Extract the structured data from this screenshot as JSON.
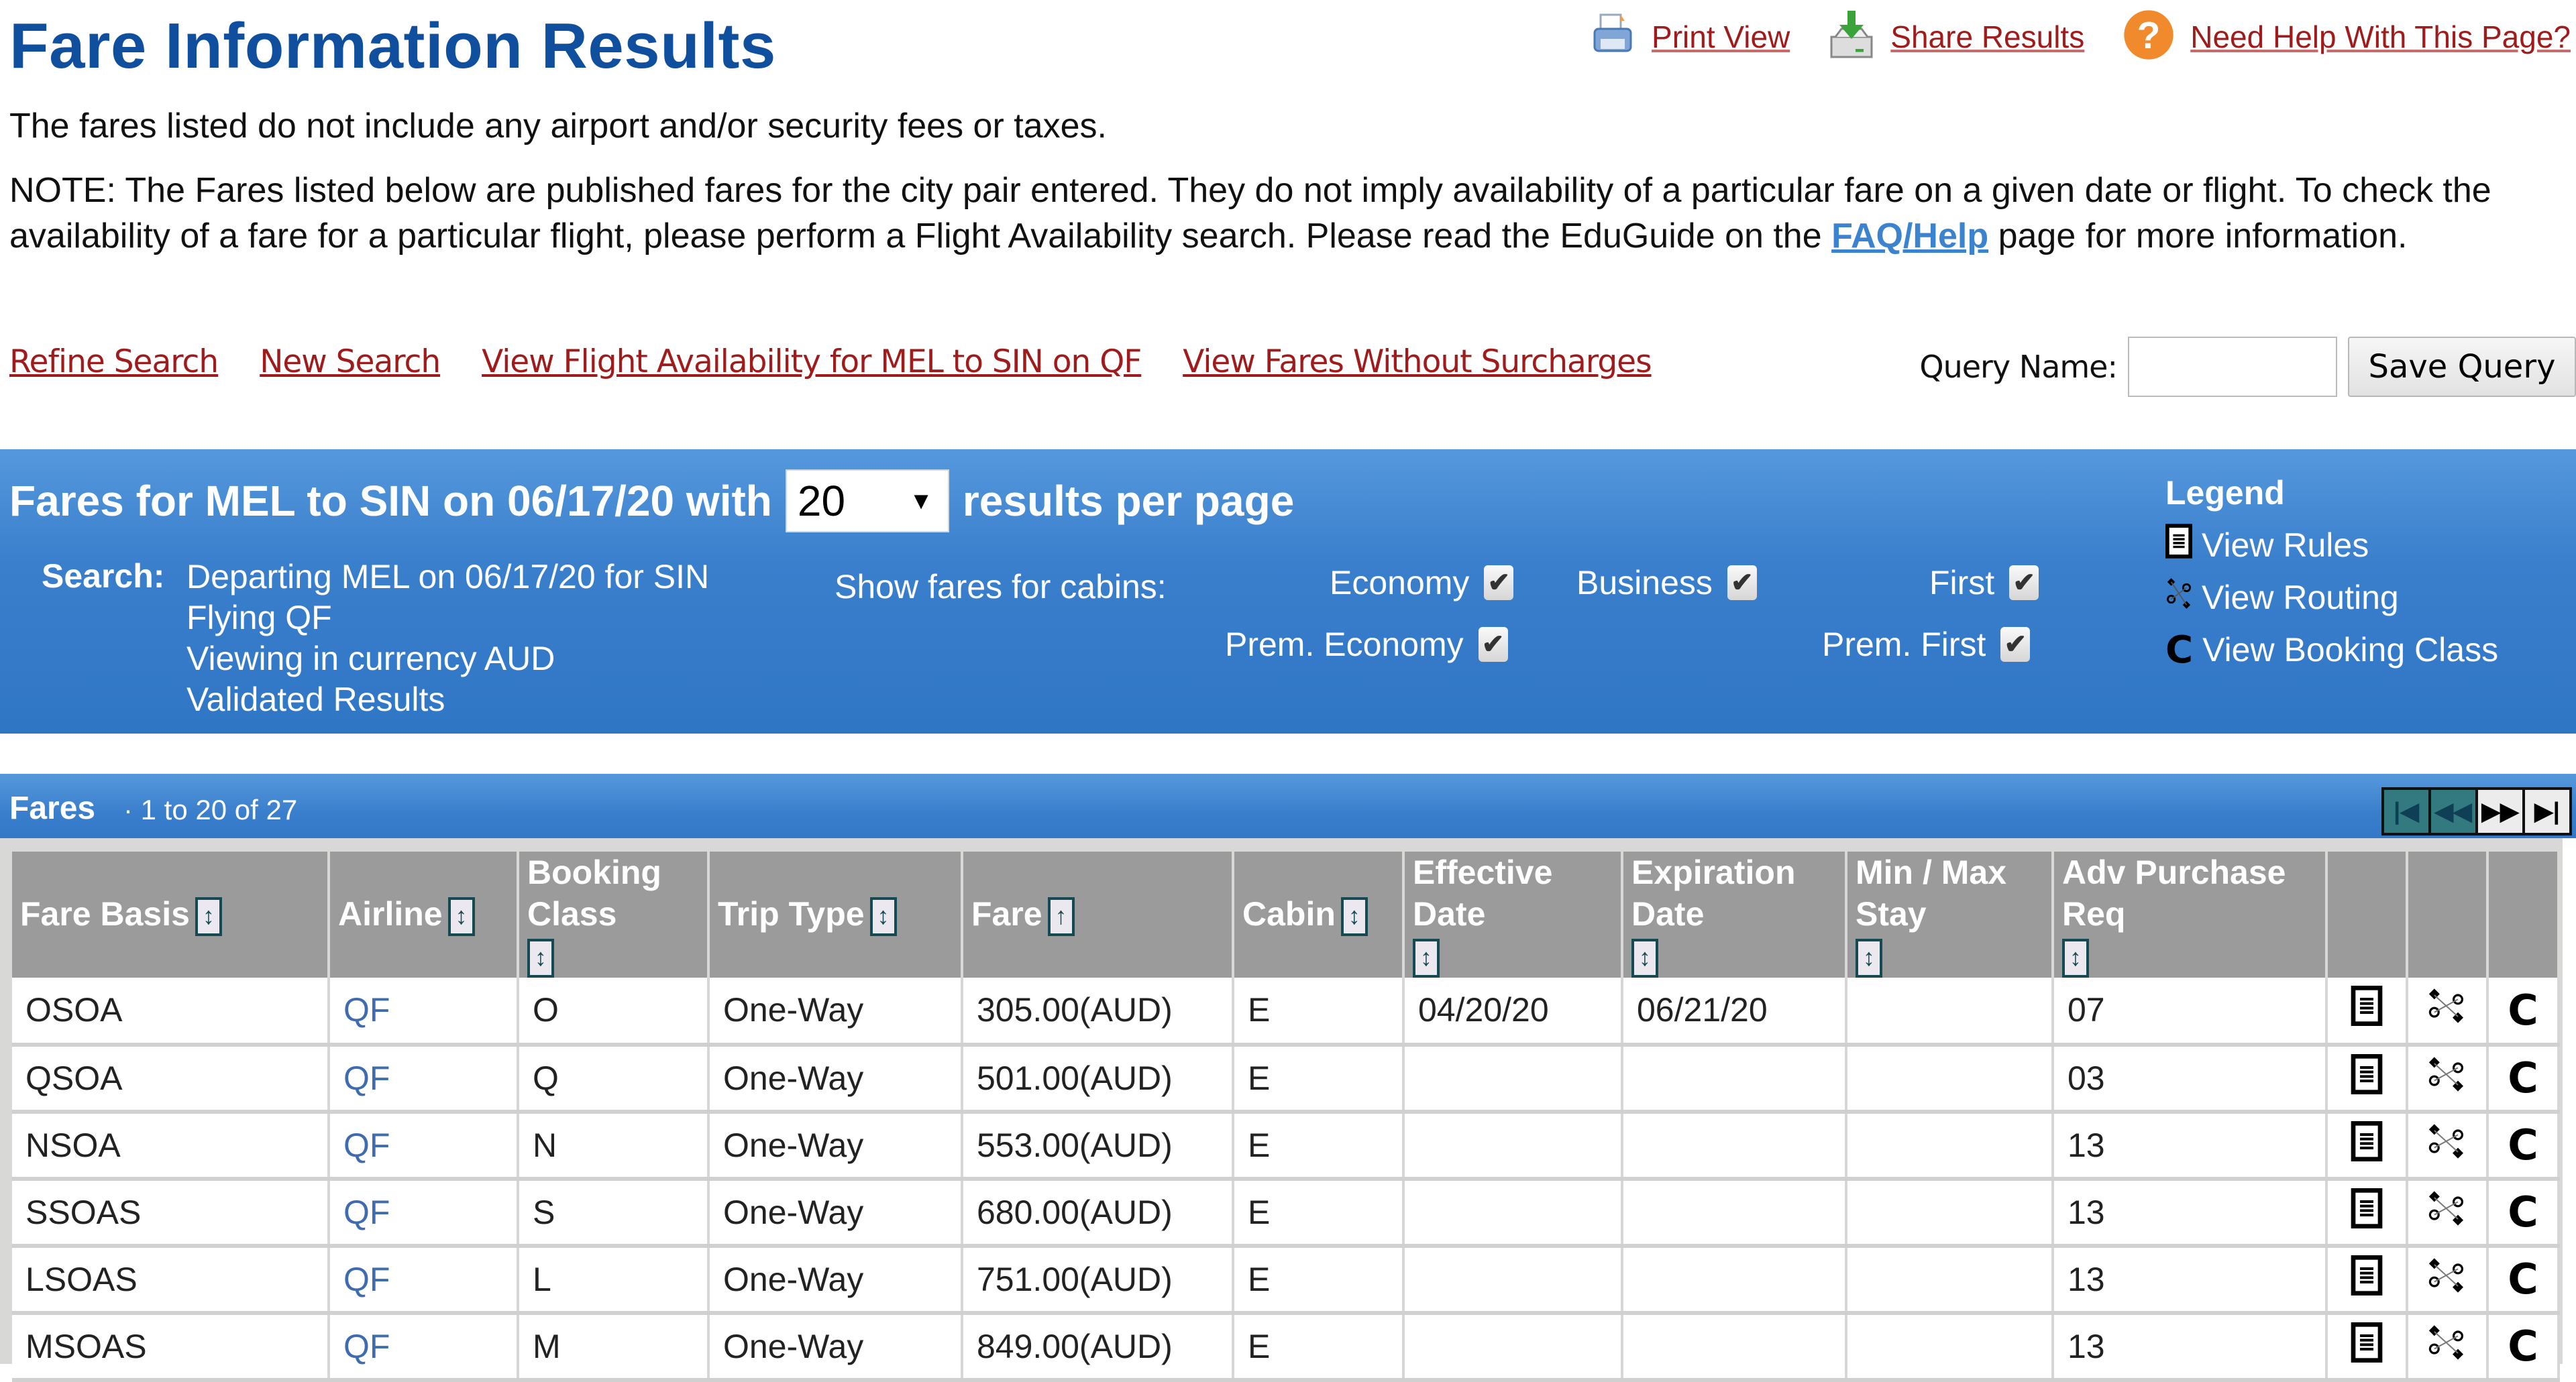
{
  "header": {
    "title": "Fare Information Results",
    "top_links": [
      {
        "label": "Print View",
        "icon": "printer-icon"
      },
      {
        "label": "Share Results",
        "icon": "download-icon"
      },
      {
        "label": "Need Help With This Page?",
        "icon": "help-icon"
      }
    ]
  },
  "intro": {
    "disclaimer": "The fares listed do not include any airport and/or security fees or taxes.",
    "note_part1": "NOTE: The Fares listed below are published fares for the city pair entered. They do not imply availability of a particular fare on a given date or flight. To check the availability of a fare for a particular flight, please perform a Flight Availability search. Please read the EduGuide on the ",
    "note_link": "FAQ/Help",
    "note_part2": " page for more information."
  },
  "actions": {
    "links": [
      "Refine Search",
      "New Search",
      "View Flight Availability for MEL to SIN on QF",
      "View Fares Without Surcharges"
    ],
    "query_label": "Query Name:",
    "query_value": "",
    "save_label": "Save Query"
  },
  "summary": {
    "title_prefix": "Fares for MEL to SIN on 06/17/20 with",
    "per_page": "20",
    "title_suffix": "results per page",
    "search_label": "Search:",
    "search_lines": [
      "Departing MEL on 06/17/20 for SIN",
      "Flying QF",
      "Viewing in currency AUD",
      "Validated Results"
    ],
    "cabins_label": "Show fares for cabins:",
    "cabins": [
      {
        "label": "Economy",
        "checked": true
      },
      {
        "label": "Business",
        "checked": true
      },
      {
        "label": "First",
        "checked": true
      },
      {
        "label": "Prem. Economy",
        "checked": true
      },
      {
        "label": "Prem. First",
        "checked": true
      }
    ],
    "legend_title": "Legend",
    "legend": [
      {
        "label": "View Rules",
        "icon": "rules-icon"
      },
      {
        "label": "View Routing",
        "icon": "routing-icon"
      },
      {
        "label": "View Booking Class",
        "icon": "booking-class-icon"
      }
    ]
  },
  "fares": {
    "label": "Fares",
    "count": "1 to 20 of 27",
    "pager": [
      "first",
      "previous",
      "next",
      "last"
    ],
    "columns": [
      {
        "label": "Fare Basis",
        "sort": "both"
      },
      {
        "label": "Airline",
        "sort": "both"
      },
      {
        "label": "Booking Class",
        "sort": "both"
      },
      {
        "label": "Trip Type",
        "sort": "both"
      },
      {
        "label": "Fare",
        "sort": "asc"
      },
      {
        "label": "Cabin",
        "sort": "both"
      },
      {
        "label": "Effective Date",
        "sort": "both"
      },
      {
        "label": "Expiration Date",
        "sort": "both"
      },
      {
        "label": "Min / Max Stay",
        "sort": "both"
      },
      {
        "label": "Adv Purchase Req",
        "sort": "both"
      }
    ],
    "rows": [
      {
        "fare_basis": "OSOA",
        "airline": "QF",
        "booking_class": "O",
        "trip_type": "One-Way",
        "fare": "305.00(AUD)",
        "cabin": "E",
        "effective": "04/20/20",
        "expiration": "06/21/20",
        "stay": "",
        "adv": "07"
      },
      {
        "fare_basis": "QSOA",
        "airline": "QF",
        "booking_class": "Q",
        "trip_type": "One-Way",
        "fare": "501.00(AUD)",
        "cabin": "E",
        "effective": "",
        "expiration": "",
        "stay": "",
        "adv": "03"
      },
      {
        "fare_basis": "NSOA",
        "airline": "QF",
        "booking_class": "N",
        "trip_type": "One-Way",
        "fare": "553.00(AUD)",
        "cabin": "E",
        "effective": "",
        "expiration": "",
        "stay": "",
        "adv": "13"
      },
      {
        "fare_basis": "SSOAS",
        "airline": "QF",
        "booking_class": "S",
        "trip_type": "One-Way",
        "fare": "680.00(AUD)",
        "cabin": "E",
        "effective": "",
        "expiration": "",
        "stay": "",
        "adv": "13"
      },
      {
        "fare_basis": "LSOAS",
        "airline": "QF",
        "booking_class": "L",
        "trip_type": "One-Way",
        "fare": "751.00(AUD)",
        "cabin": "E",
        "effective": "",
        "expiration": "",
        "stay": "",
        "adv": "13"
      },
      {
        "fare_basis": "MSOAS",
        "airline": "QF",
        "booking_class": "M",
        "trip_type": "One-Way",
        "fare": "849.00(AUD)",
        "cabin": "E",
        "effective": "",
        "expiration": "",
        "stay": "",
        "adv": "13"
      }
    ]
  },
  "colors": {
    "title_blue": "#0f4f9e",
    "link_red": "#a01b1b",
    "panel_blue": "#3a7fcc",
    "header_gray": "#9b9b9b",
    "airline_link": "#3f6bb0"
  }
}
